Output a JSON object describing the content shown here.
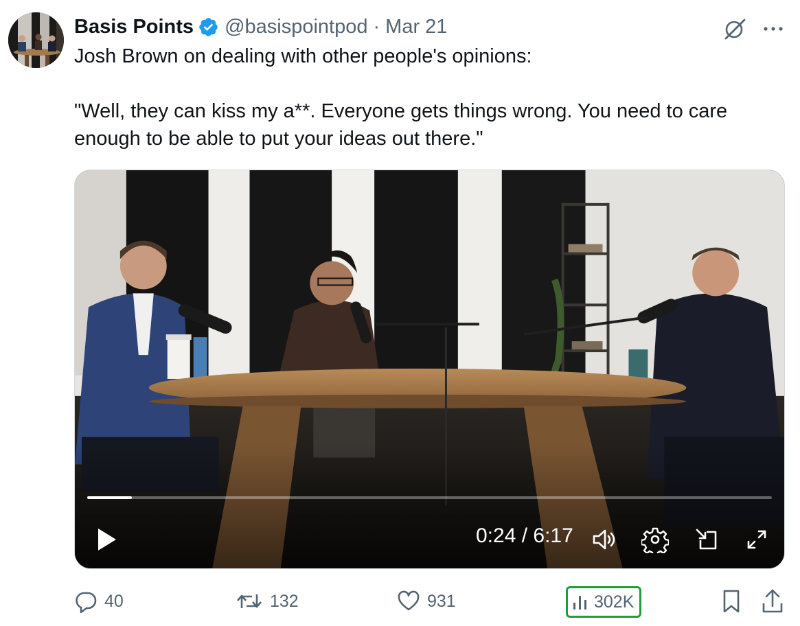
{
  "author": {
    "display_name": "Basis Points",
    "handle": "@basispointpod",
    "separator": "·",
    "date": "Mar 21"
  },
  "colors": {
    "verified": "#1d9bf0",
    "secondary_text": "#536471",
    "highlight_border": "#1e9e3a"
  },
  "tweet": {
    "line1": "Josh Brown on dealing with other people's opinions:",
    "line2": "\"Well, they can kiss my a**. Everyone gets things wrong. You need to care enough to be able to put your ideas out there.\""
  },
  "video": {
    "time_display": "0:24 / 6:17",
    "progress_fraction": 0.065,
    "controls": [
      "play-icon",
      "volume-icon",
      "settings-icon",
      "pip-icon",
      "fullscreen-icon"
    ]
  },
  "actions": {
    "replies": "40",
    "reposts": "132",
    "likes": "931",
    "views": "302K",
    "icons": [
      "reply-icon",
      "repost-icon",
      "like-icon",
      "views-icon",
      "bookmark-icon",
      "share-icon"
    ]
  }
}
